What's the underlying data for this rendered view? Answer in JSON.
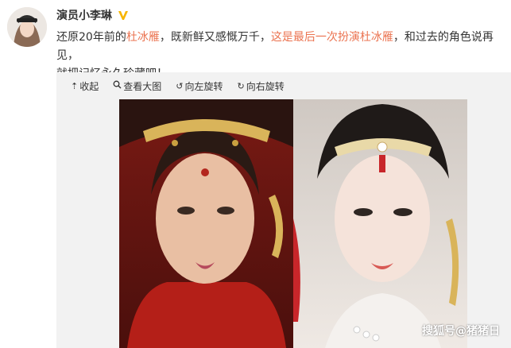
{
  "post": {
    "username": "演员小李琳",
    "text_part1": "还原20年前的",
    "text_link1": "杜冰雁",
    "text_part2": "，既新鲜又感慨万千，",
    "text_link2": "这是最后一次扮演杜冰雁",
    "text_part3": "，和过去的角色说再见，",
    "text_part4": "就把记忆永久珍藏吧！"
  },
  "toolbar": {
    "collapse_label": "收起",
    "view_large_label": "查看大图",
    "rotate_left_label": "向左旋转",
    "rotate_right_label": "向右旋转"
  },
  "watermark": "搜狐号@猪猪日",
  "icons": {
    "verified": "verified-badge-icon",
    "collapse": "arrow-up-icon",
    "view_large": "magnifier-icon",
    "rotate_left": "rotate-left-icon",
    "rotate_right": "rotate-right-icon"
  },
  "colors": {
    "highlight": "#eb7350",
    "verified": "#f7b500",
    "media_bg": "#f2f2f2"
  }
}
